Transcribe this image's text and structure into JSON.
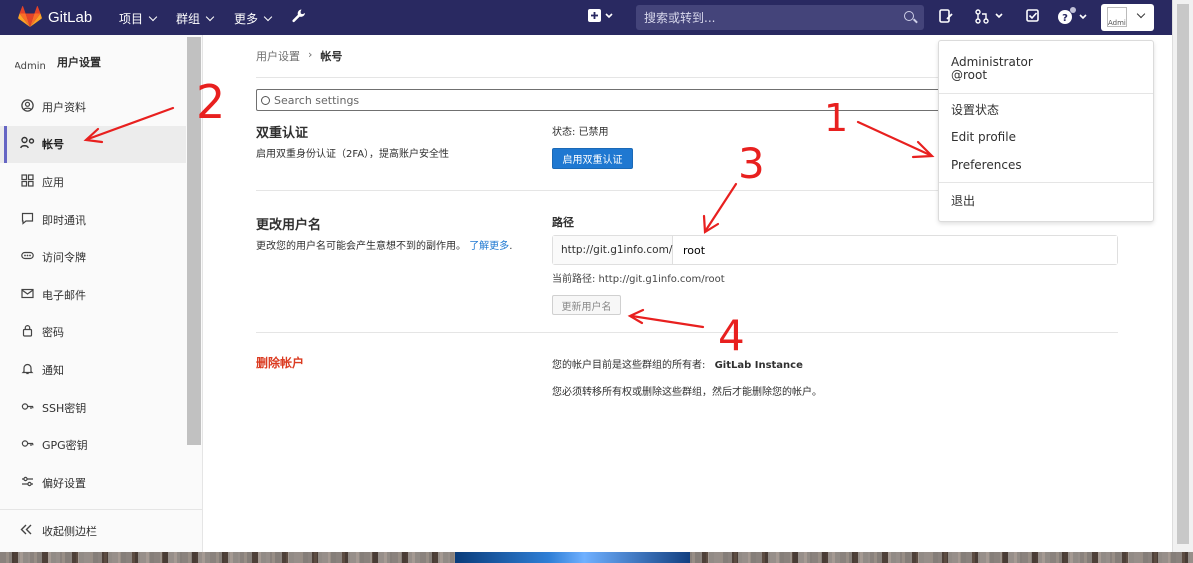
{
  "navbar": {
    "brand": "GitLab",
    "menu": [
      {
        "label": "项目"
      },
      {
        "label": "群组"
      },
      {
        "label": "更多"
      }
    ],
    "search_placeholder": "搜索或转到...",
    "avatar_alt": "Administ"
  },
  "sidebar": {
    "avatar_alt": "Admin",
    "title": "用户设置",
    "items": [
      {
        "label": "用户资料",
        "icon": "user-circle-icon"
      },
      {
        "label": "帐号",
        "icon": "account-icon"
      },
      {
        "label": "应用",
        "icon": "applications-icon"
      },
      {
        "label": "即时通讯",
        "icon": "chat-icon"
      },
      {
        "label": "访问令牌",
        "icon": "token-icon"
      },
      {
        "label": "电子邮件",
        "icon": "mail-icon"
      },
      {
        "label": "密码",
        "icon": "lock-icon"
      },
      {
        "label": "通知",
        "icon": "bell-icon"
      },
      {
        "label": "SSH密钥",
        "icon": "key-icon"
      },
      {
        "label": "GPG密钥",
        "icon": "key-icon"
      },
      {
        "label": "偏好设置",
        "icon": "preferences-icon"
      }
    ],
    "active_index": 1,
    "collapse_label": "收起侧边栏"
  },
  "breadcrumb": {
    "parent": "用户设置",
    "separator": "›",
    "current": "帐号"
  },
  "settings_search": {
    "placeholder": "Search settings"
  },
  "two_factor": {
    "title": "双重认证",
    "description": "启用双重身份认证（2FA），提高账户安全性",
    "status": "状态: 已禁用",
    "button": "启用双重认证"
  },
  "username": {
    "title": "更改用户名",
    "description": "更改您的用户名可能会产生意想不到的副作用。",
    "learn_more": "了解更多",
    "learn_more_end": ".",
    "path_label": "路径",
    "prefix": "http://git.g1info.com/",
    "value": "root",
    "current_path": "当前路径:  http://git.g1info.com/root",
    "button": "更新用户名"
  },
  "delete_account": {
    "title": "删除帐户",
    "owner_text": "您的帐户目前是这些群组的所有者:",
    "owner_group": "GitLab Instance",
    "note": "您必须转移所有权或删除这些群组，然后才能删除您的帐户。"
  },
  "user_dropdown": {
    "name": "Administrator",
    "username": "@root",
    "items": [
      "设置状态",
      "Edit profile",
      "Preferences"
    ],
    "signout": "退出"
  },
  "annotations": [
    "1",
    "2",
    "3",
    "4"
  ],
  "colors": {
    "navbar": "#292961",
    "primary": "#1f78d1",
    "danger": "#db3b21",
    "annotation": "#e8201f"
  }
}
